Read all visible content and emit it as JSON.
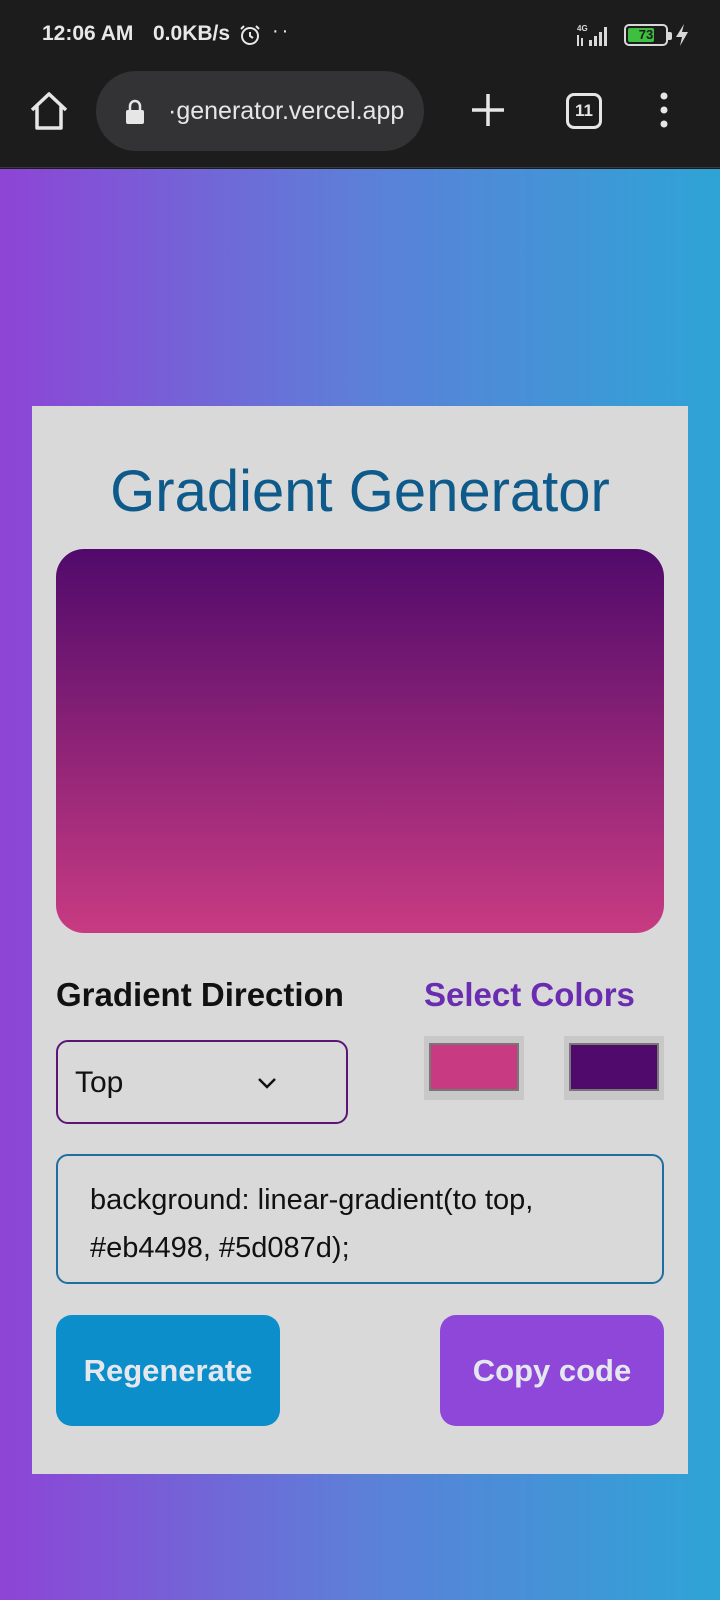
{
  "status_bar": {
    "time": "12:06 AM",
    "net_speed": "0.0KB/s",
    "dots": "··",
    "network_label": "4G",
    "battery_level": "73",
    "battery_fraction": 0.73,
    "icons": [
      "alarm-icon",
      "signal-icon",
      "battery-icon",
      "bolt-icon"
    ]
  },
  "browser": {
    "url": "·generator.vercel.app",
    "tab_count": "11",
    "icons": [
      "home-icon",
      "lock-icon",
      "plus-icon",
      "tabs-icon",
      "overflow-menu-icon"
    ]
  },
  "app": {
    "title": "Gradient Generator",
    "direction_label": "Gradient Direction",
    "colors_label": "Select Colors",
    "direction_value": "Top",
    "color_1": "#c83b82",
    "color_2": "#500a6b",
    "code": "background: linear-gradient(to top, #eb4498, #5d087d);",
    "regenerate_label": "Regenerate",
    "copy_label": "Copy code"
  },
  "colors": {
    "page_gradient": [
      "#8e44d6",
      "#5d7fd8",
      "#2ea4d6"
    ],
    "card_bg": "#d9d9d9",
    "title_color": "#0e5a8a",
    "regenerate_bg": "#0c8ecb",
    "copy_bg": "#8e47d8"
  }
}
